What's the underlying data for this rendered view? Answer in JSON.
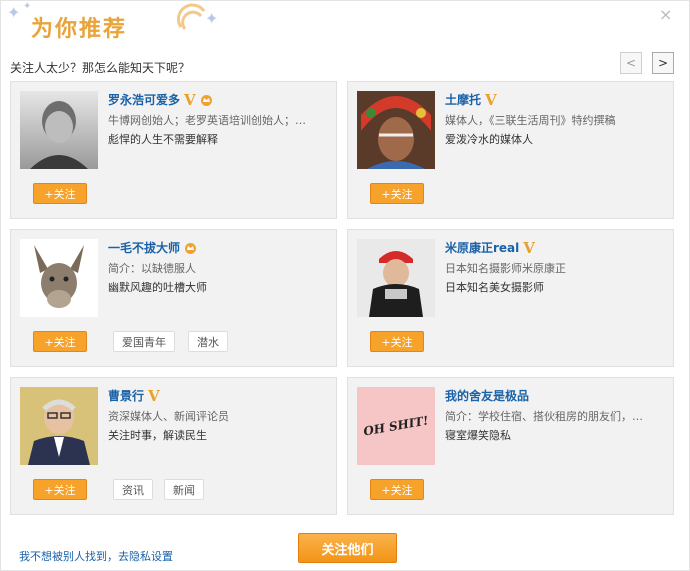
{
  "header": {
    "title": "为你推荐",
    "close_symbol": "×"
  },
  "subtitle": "关注人太少？那怎么能知天下呢？",
  "pager": {
    "prev_symbol": "<",
    "next_symbol": ">"
  },
  "cards": [
    {
      "name": "罗永浩可爱多",
      "verified": "V",
      "intro": "牛博网创始人；老罗英语培训创始人；…",
      "desc": "彪悍的人生不需要解释",
      "follow_label": "+关注",
      "tags": []
    },
    {
      "name": "土摩托",
      "verified": "V",
      "intro": "媒体人，《三联生活周刊》特约撰稿",
      "desc": "爱泼冷水的媒体人",
      "follow_label": "+关注",
      "tags": []
    },
    {
      "name": "一毛不拔大师",
      "verified": "",
      "intro": "简介：以缺德服人",
      "desc": "幽默风趣的吐槽大师",
      "follow_label": "+关注",
      "tags": [
        "爱国青年",
        "潜水"
      ]
    },
    {
      "name": "米原康正real",
      "verified": "V",
      "intro": "日本知名摄影师米原康正",
      "desc": "日本知名美女摄影师",
      "follow_label": "+关注",
      "tags": []
    },
    {
      "name": "曹景行",
      "verified": "V",
      "intro": "资深媒体人、新闻评论员",
      "desc": "关注时事，解读民生",
      "follow_label": "+关注",
      "tags": [
        "资讯",
        "新闻"
      ]
    },
    {
      "name": "我的舍友是极品",
      "verified": "",
      "intro": "简介：学校住宿、搭伙租房的朋友们，…",
      "desc": "寝室爆笑隐私",
      "follow_label": "+关注",
      "tags": []
    }
  ],
  "avatar_text": {
    "card6": "OH SHIT!"
  },
  "footer": {
    "privacy_link": "我不想被别人找到，去隐私设置",
    "follow_all": "关注他们"
  },
  "colors": {
    "accent": "#f6a22b",
    "link": "#1a62a8",
    "card_bg": "#f2f2f2"
  }
}
